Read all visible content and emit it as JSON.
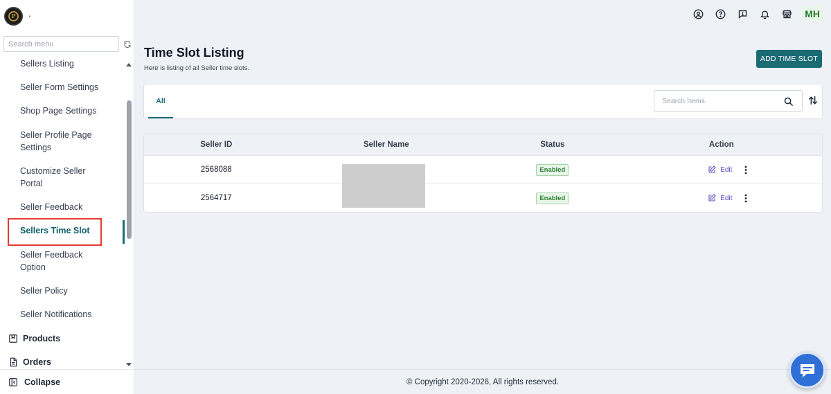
{
  "sidebar": {
    "brand": ".",
    "logo_letter": "P",
    "search_placeholder": "Search menu",
    "items": [
      {
        "label": "Sellers Listing"
      },
      {
        "label": "Seller Form Settings"
      },
      {
        "label": "Shop Page Settings"
      },
      {
        "label": "Seller Profile Page Settings"
      },
      {
        "label": "Customize Seller Portal"
      },
      {
        "label": "Seller Feedback"
      },
      {
        "label": "Sellers Time Slot",
        "active": true
      },
      {
        "label": "Seller Feedback Option"
      },
      {
        "label": "Seller Policy"
      },
      {
        "label": "Seller Notifications"
      }
    ],
    "sections": [
      {
        "label": "Products",
        "icon": "bookmark-box-icon"
      },
      {
        "label": "Orders",
        "icon": "document-icon"
      }
    ],
    "collapse_label": "Collapse"
  },
  "topbar": {
    "icons": [
      "user-circle-icon",
      "help-icon",
      "feedback-icon",
      "bell-icon",
      "store-icon"
    ],
    "avatar_initials": "MH"
  },
  "page": {
    "title": "Time Slot Listing",
    "subtitle": "Here is listing of all Seller time slots.",
    "add_button": "ADD TIME SLOT"
  },
  "filters": {
    "tabs": [
      {
        "label": "All",
        "active": true
      }
    ],
    "search_placeholder": "Search Items"
  },
  "table": {
    "columns": [
      "Seller ID",
      "Seller Name",
      "Status",
      "Action"
    ],
    "rows": [
      {
        "seller_id": "2568088",
        "seller_name": "",
        "status": "Enabled",
        "action": "Edit"
      },
      {
        "seller_id": "2564717",
        "seller_name": "",
        "status": "Enabled",
        "action": "Edit"
      }
    ]
  },
  "footer": {
    "copyright": "© Copyright 2020-2026, All rights reserved."
  },
  "colors": {
    "accent": "#1b6b73",
    "status_green": "#2e7d32",
    "edit_purple": "#5b4bc4",
    "chat_blue": "#2f6fd6",
    "highlight_red": "#e53935"
  }
}
